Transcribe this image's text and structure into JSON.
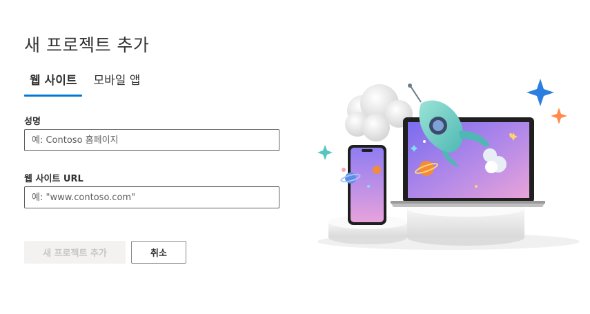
{
  "page": {
    "title": "새 프로젝트 추가"
  },
  "tabs": [
    {
      "label": "웹 사이트",
      "active": true
    },
    {
      "label": "모바일 앱",
      "active": false
    }
  ],
  "form": {
    "name_label": "성명",
    "name_placeholder": "예: Contoso 홈페이지",
    "name_value": "",
    "url_label": "웹 사이트 URL",
    "url_placeholder": "예: \"www.contoso.com\"",
    "url_value": ""
  },
  "buttons": {
    "add_label": "새 프로젝트 추가",
    "add_enabled": false,
    "cancel_label": "취소"
  },
  "colors": {
    "accent": "#0078d4",
    "disabled_bg": "#f3f2f1",
    "disabled_text": "#c8c6c4"
  },
  "illustration": {
    "icons": [
      "cloud-icon",
      "phone-icon",
      "laptop-icon",
      "rocket-icon",
      "planet-icon",
      "sparkle-icon"
    ]
  }
}
